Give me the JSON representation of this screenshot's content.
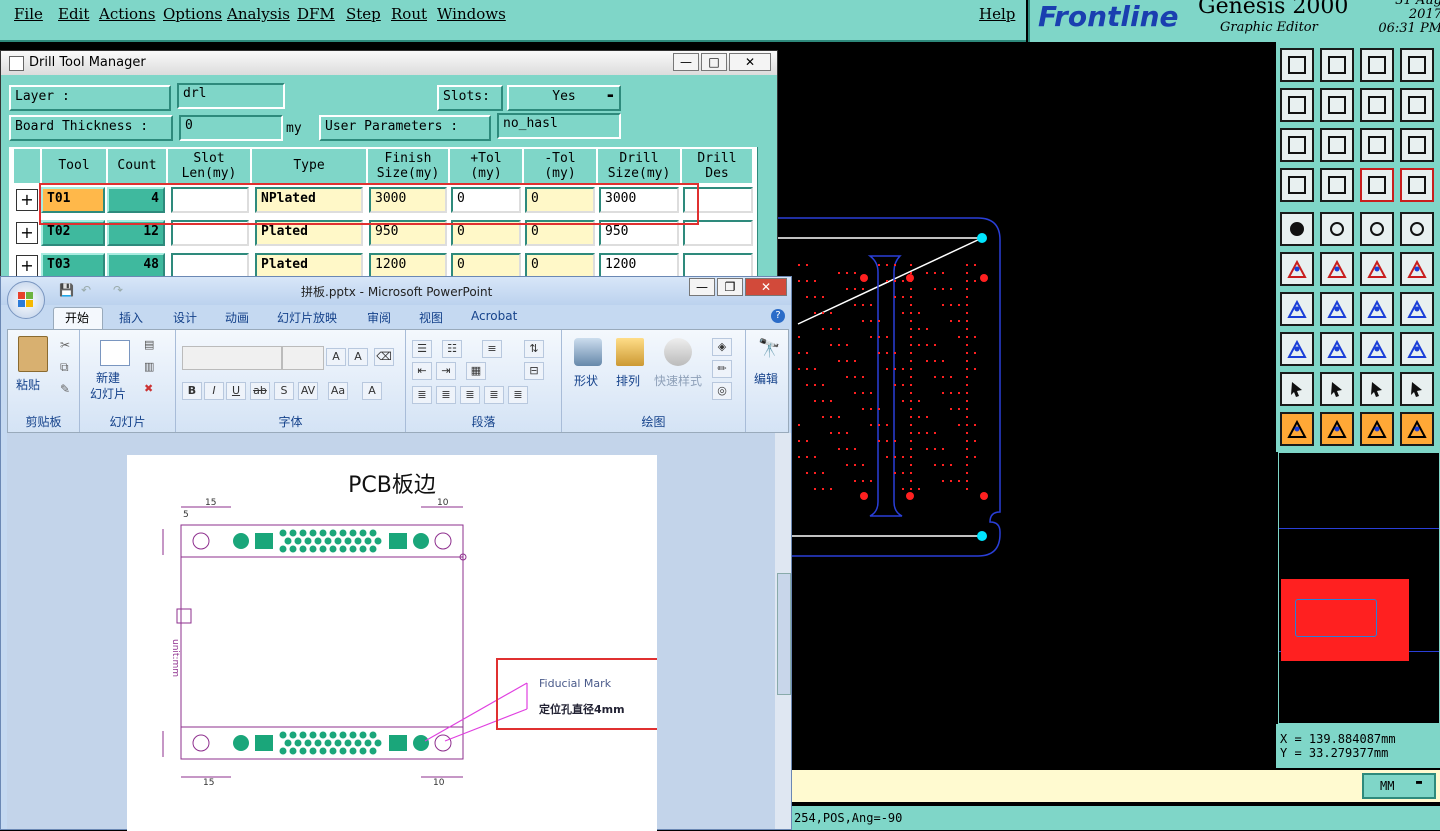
{
  "menu": {
    "items": [
      "File",
      "Edit",
      "Actions",
      "Options",
      "Analysis",
      "DFM",
      "Step",
      "Rout",
      "Windows"
    ],
    "help": "Help"
  },
  "brand": {
    "logo": "Frontline",
    "product": "Genesis 2000",
    "subtitle": "Graphic Editor",
    "date": "31 Aug 2017",
    "time": "06:31 PM"
  },
  "coords": {
    "x": "X = 139.884087mm",
    "y": "Y = 33.279377mm"
  },
  "units": "MM",
  "status_line": "254,POS,Ang=-90",
  "drill": {
    "title": "Drill Tool Manager",
    "layer_label": "Layer           :",
    "layer_value": "drl",
    "slots_label": "Slots:",
    "slots_value": "Yes",
    "thickness_label": "Board Thickness :",
    "thickness_value": "0",
    "thickness_unit": "my",
    "params_label": "User Parameters :",
    "params_value": "no_hasl",
    "headers": {
      "tool": "Tool",
      "count": "Count",
      "slot": "Slot\nLen(my)",
      "type": "Type",
      "finish": "Finish\nSize(my)",
      "ptol": "+Tol\n(my)",
      "mtol": "-Tol\n(my)",
      "drill": "Drill\nSize(my)",
      "des": "Drill\nDes"
    },
    "rows": [
      {
        "tool": "T01",
        "count": "4",
        "type": "NPlated",
        "finish": "3000",
        "ptol": "0",
        "mtol": "0",
        "drill": "3000"
      },
      {
        "tool": "T02",
        "count": "12",
        "type": "Plated",
        "finish": "950",
        "ptol": "0",
        "mtol": "0",
        "drill": "950"
      },
      {
        "tool": "T03",
        "count": "48",
        "type": "Plated",
        "finish": "1200",
        "ptol": "0",
        "mtol": "0",
        "drill": "1200"
      }
    ]
  },
  "ppt": {
    "title": "拼板.pptx - Microsoft PowerPoint",
    "tabs": [
      "开始",
      "插入",
      "设计",
      "动画",
      "幻灯片放映",
      "审阅",
      "视图",
      "Acrobat"
    ],
    "groups": {
      "clipboard": "剪贴板",
      "slides": "幻灯片",
      "font": "字体",
      "paragraph": "段落",
      "drawing": "绘图"
    },
    "buttons": {
      "paste": "粘贴",
      "new_slide": "新建\n幻灯片",
      "shape": "形状",
      "arrange": "排列",
      "quick_style": "快速样式",
      "edit": "编辑"
    },
    "slide": {
      "title": "PCB板边",
      "dim_15": "15",
      "dim_5": "5",
      "dim_10": "10",
      "unit_label": "unit:mm",
      "callout1": "Fiducial Mark",
      "callout2": "定位孔直径4mm"
    }
  },
  "colors": {
    "genesis_bg": "#7fd6c8",
    "highlight": "#e03030",
    "pad_red": "#ff2020",
    "fiducial": "#00e5ff",
    "pcb_green": "#1aa67a",
    "slide_line": "#8e2f8e"
  }
}
